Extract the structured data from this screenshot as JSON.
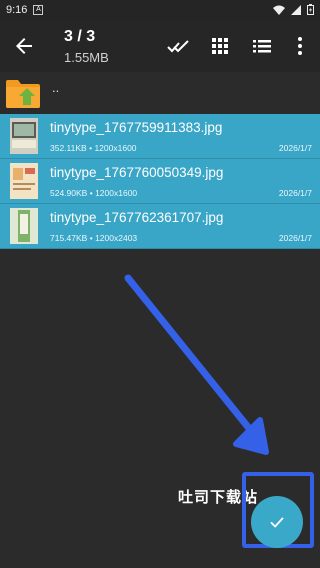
{
  "status_bar": {
    "time": "9:16",
    "app_badge": "A"
  },
  "toolbar": {
    "title": "3 / 3",
    "subtitle": "1.55MB"
  },
  "parent_entry": {
    "label": ".."
  },
  "files": [
    {
      "name": "tinytype_1767759911383.jpg",
      "size": "352.11KB",
      "dimensions": "1200x1600",
      "date": "2026/1/7"
    },
    {
      "name": "tinytype_1767760050349.jpg",
      "size": "524.90KB",
      "dimensions": "1200x1600",
      "date": "2026/1/7"
    },
    {
      "name": "tinytype_1767762361707.jpg",
      "size": "715.47KB",
      "dimensions": "1200x2403",
      "date": "2026/1/7"
    }
  ],
  "meta_separator": "•",
  "watermark": "吐司下载站",
  "colors": {
    "accent": "#39a6c7",
    "annotation": "#3560e8",
    "background": "#2b2b2b"
  }
}
